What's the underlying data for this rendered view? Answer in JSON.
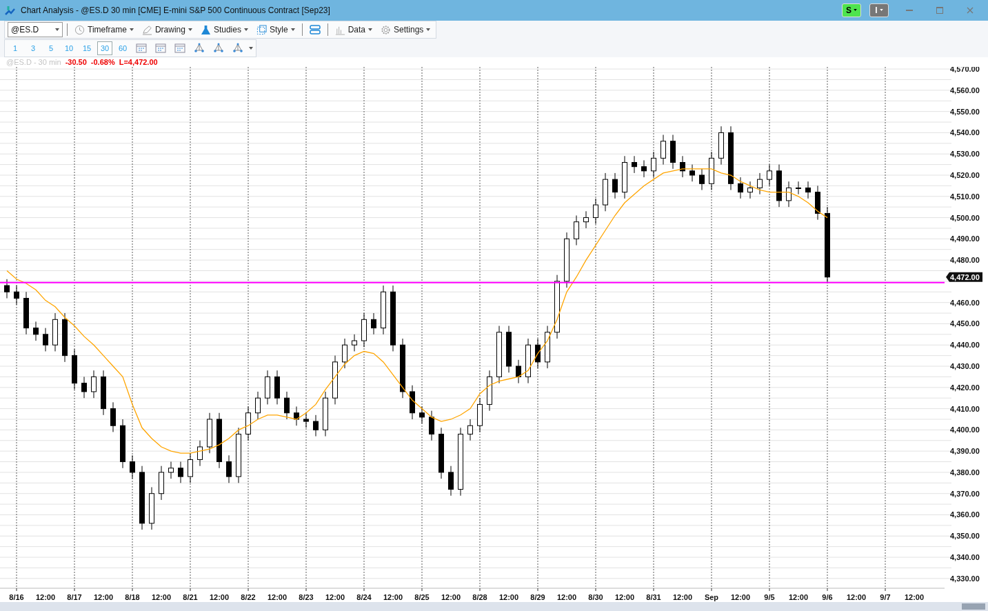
{
  "window": {
    "title": "Chart Analysis - @ES.D 30 min [CME] E-mini S&P 500 Continuous Contract [Sep23]",
    "badges": [
      {
        "label": "S",
        "kind": "green"
      },
      {
        "label": "I",
        "kind": "grey"
      }
    ]
  },
  "toolbar": {
    "symbol": "@ES.D",
    "menus": [
      {
        "label": "Timeframe"
      },
      {
        "label": "Drawing"
      },
      {
        "label": "Studies"
      },
      {
        "label": "Style"
      },
      {
        "label": "Data"
      },
      {
        "label": "Settings"
      }
    ]
  },
  "intervals": [
    {
      "label": "1",
      "selected": false
    },
    {
      "label": "3",
      "selected": false
    },
    {
      "label": "5",
      "selected": false
    },
    {
      "label": "10",
      "selected": false
    },
    {
      "label": "15",
      "selected": false
    },
    {
      "label": "30",
      "selected": true
    },
    {
      "label": "60",
      "selected": false
    }
  ],
  "info": {
    "symbol": "@ES.D - 30 min",
    "change": "-30.50",
    "percent": "-0.68%",
    "last": "L=4,472.00"
  },
  "chart": {
    "price_tag": "4,472.00",
    "chart_data": {
      "type": "candlestick",
      "grid": true,
      "ylim": [
        4325.4,
        4571
      ],
      "categories": [
        null,
        "8/16",
        null,
        null,
        "12:00",
        null,
        null,
        "8/17",
        null,
        null,
        "12:00",
        null,
        null,
        "8/18",
        null,
        null,
        "12:00",
        null,
        null,
        "8/21",
        null,
        null,
        "12:00",
        null,
        null,
        "8/22",
        null,
        null,
        "12:00",
        null,
        null,
        "8/23",
        null,
        null,
        "12:00",
        null,
        null,
        "8/24",
        null,
        null,
        "12:00",
        null,
        null,
        "8/25",
        null,
        null,
        "12:00",
        null,
        null,
        "8/28",
        null,
        null,
        "12:00",
        null,
        null,
        "8/29",
        null,
        null,
        "12:00",
        null,
        null,
        "8/30",
        null,
        null,
        "12:00",
        null,
        null,
        "8/31",
        null,
        null,
        "12:00",
        null,
        null,
        "Sep",
        null,
        null,
        "12:00",
        null,
        null,
        "9/5",
        null,
        null,
        "12:00",
        null,
        null,
        "9/6",
        null,
        null,
        "12:00",
        null,
        null,
        "9/7",
        null,
        null,
        "12:00",
        null
      ],
      "ohlc": [
        [
          4468,
          4471,
          4462,
          4465
        ],
        [
          4465,
          4468,
          4459,
          4462
        ],
        [
          4462,
          4465,
          4445,
          4448
        ],
        [
          4448,
          4451,
          4442,
          4445
        ],
        [
          4445,
          4448,
          4437,
          4440
        ],
        [
          4440,
          4455,
          4437,
          4452
        ],
        [
          4452,
          4455,
          4432,
          4435
        ],
        [
          4435,
          4438,
          4419,
          4422
        ],
        [
          4422,
          4425,
          4415,
          4418
        ],
        [
          4418,
          4428,
          4415,
          4425
        ],
        [
          4425,
          4428,
          4407,
          4410
        ],
        [
          4410,
          4413,
          4399,
          4402
        ],
        [
          4402,
          4405,
          4382,
          4385
        ],
        [
          4385,
          4388,
          4377,
          4380
        ],
        [
          4380,
          4383,
          4353,
          4356
        ],
        [
          4356,
          4373,
          4353,
          4370
        ],
        [
          4370,
          4383,
          4367,
          4380
        ],
        [
          4380,
          4385,
          4377,
          4382
        ],
        [
          4382,
          4385,
          4375,
          4378
        ],
        [
          4378,
          4389,
          4375,
          4386
        ],
        [
          4386,
          4395,
          4383,
          4392
        ],
        [
          4392,
          4408,
          4389,
          4405
        ],
        [
          4405,
          4408,
          4382,
          4385
        ],
        [
          4385,
          4388,
          4375,
          4378
        ],
        [
          4378,
          4401,
          4375,
          4398
        ],
        [
          4398,
          4411,
          4395,
          4408
        ],
        [
          4408,
          4418,
          4405,
          4415
        ],
        [
          4415,
          4428,
          4412,
          4425
        ],
        [
          4425,
          4428,
          4412,
          4415
        ],
        [
          4415,
          4418,
          4405,
          4408
        ],
        [
          4408,
          4411,
          4402,
          4405
        ],
        [
          4405,
          4408,
          4401,
          4404
        ],
        [
          4404,
          4407,
          4397,
          4400
        ],
        [
          4400,
          4418,
          4397,
          4415
        ],
        [
          4415,
          4435,
          4412,
          4432
        ],
        [
          4432,
          4443,
          4429,
          4440
        ],
        [
          4440,
          4445,
          4437,
          4442
        ],
        [
          4442,
          4455,
          4439,
          4452
        ],
        [
          4452,
          4455,
          4445,
          4448
        ],
        [
          4448,
          4468,
          4445,
          4465
        ],
        [
          4465,
          4468,
          4437,
          4440
        ],
        [
          4440,
          4443,
          4415,
          4418
        ],
        [
          4418,
          4421,
          4405,
          4408
        ],
        [
          4408,
          4411,
          4403,
          4406
        ],
        [
          4406,
          4409,
          4395,
          4398
        ],
        [
          4398,
          4401,
          4377,
          4380
        ],
        [
          4380,
          4383,
          4369,
          4372
        ],
        [
          4372,
          4401,
          4369,
          4398
        ],
        [
          4398,
          4405,
          4395,
          4402
        ],
        [
          4402,
          4415,
          4399,
          4412
        ],
        [
          4412,
          4428,
          4409,
          4425
        ],
        [
          4425,
          4449,
          4422,
          4446
        ],
        [
          4446,
          4449,
          4427,
          4430
        ],
        [
          4430,
          4433,
          4422,
          4425
        ],
        [
          4425,
          4443,
          4422,
          4440
        ],
        [
          4440,
          4443,
          4429,
          4432
        ],
        [
          4432,
          4449,
          4429,
          4446
        ],
        [
          4446,
          4473,
          4443,
          4470
        ],
        [
          4470,
          4493,
          4467,
          4490
        ],
        [
          4490,
          4501,
          4487,
          4498
        ],
        [
          4498,
          4503,
          4495,
          4500
        ],
        [
          4500,
          4509,
          4497,
          4506
        ],
        [
          4506,
          4521,
          4503,
          4518
        ],
        [
          4518,
          4521,
          4509,
          4512
        ],
        [
          4512,
          4529,
          4509,
          4526
        ],
        [
          4526,
          4529,
          4521,
          4524
        ],
        [
          4524,
          4527,
          4519,
          4522
        ],
        [
          4522,
          4531,
          4519,
          4528
        ],
        [
          4528,
          4539,
          4525,
          4536
        ],
        [
          4536,
          4539,
          4523,
          4526
        ],
        [
          4526,
          4529,
          4519,
          4522
        ],
        [
          4522,
          4525,
          4517,
          4520
        ],
        [
          4520,
          4523,
          4513,
          4516
        ],
        [
          4516,
          4531,
          4513,
          4528
        ],
        [
          4528,
          4543,
          4525,
          4540
        ],
        [
          4540,
          4543,
          4513,
          4516
        ],
        [
          4516,
          4519,
          4509,
          4512
        ],
        [
          4512,
          4517,
          4509,
          4514
        ],
        [
          4514,
          4521,
          4511,
          4518
        ],
        [
          4518,
          4525,
          4515,
          4522
        ],
        [
          4522,
          4525,
          4505,
          4508
        ],
        [
          4508,
          4517,
          4505,
          4514
        ],
        [
          4514,
          4517,
          4511,
          4514
        ],
        [
          4514,
          4517,
          4509,
          4512
        ],
        [
          4512,
          4515,
          4499,
          4502
        ],
        [
          4502,
          4505,
          4469,
          4472
        ],
        null,
        null,
        null,
        null,
        null,
        null,
        null,
        null,
        null,
        null
      ],
      "series": [
        {
          "type": "line",
          "color": "#ffa500",
          "values": [
            4475,
            4471,
            4469,
            4466,
            4461,
            4458,
            4453,
            4449,
            4444,
            4440,
            4435,
            4430,
            4425,
            4412,
            4401,
            4396,
            4392,
            4390,
            4389,
            4389,
            4390,
            4391,
            4393,
            4396,
            4400,
            4402,
            4405,
            4407,
            4407,
            4406,
            4405,
            4408,
            4412,
            4419,
            4425,
            4431,
            4435,
            4437,
            4436,
            4432,
            4426,
            4420,
            4414,
            4410,
            4406,
            4404,
            4405,
            4407,
            4410,
            4417,
            4421,
            4423,
            4424,
            4425,
            4428,
            4436,
            4442,
            4452,
            4465,
            4472,
            4480,
            4487,
            4494,
            4501,
            4507,
            4511,
            4515,
            4518,
            4521,
            4522,
            4523,
            4523,
            4523,
            4523,
            4521,
            4520,
            4517,
            4515,
            4513,
            4512,
            4512,
            4512,
            4510,
            4507,
            4503,
            4500,
            null,
            null,
            null,
            null,
            null,
            null,
            null,
            null,
            null,
            null
          ]
        }
      ],
      "ref_lines": [
        {
          "axis": "y",
          "value": 4469.4,
          "color": "#ff00ff"
        }
      ],
      "yticks": [
        {
          "value": 4570,
          "label": "4,570.00"
        },
        {
          "value": 4560,
          "label": "4,560.00"
        },
        {
          "value": 4550,
          "label": "4,550.00"
        },
        {
          "value": 4540,
          "label": "4,540.00"
        },
        {
          "value": 4530,
          "label": "4,530.00"
        },
        {
          "value": 4520,
          "label": "4,520.00"
        },
        {
          "value": 4510,
          "label": "4,510.00"
        },
        {
          "value": 4500,
          "label": "4,500.00"
        },
        {
          "value": 4490,
          "label": "4,490.00"
        },
        {
          "value": 4480,
          "label": "4,480.00"
        },
        {
          "value": 4460,
          "label": "4,460.00"
        },
        {
          "value": 4450,
          "label": "4,450.00"
        },
        {
          "value": 4440,
          "label": "4,440.00"
        },
        {
          "value": 4430,
          "label": "4,430.00"
        },
        {
          "value": 4420,
          "label": "4,420.00"
        },
        {
          "value": 4410,
          "label": "4,410.00"
        },
        {
          "value": 4400,
          "label": "4,400.00"
        },
        {
          "value": 4390,
          "label": "4,390.00"
        },
        {
          "value": 4380,
          "label": "4,380.00"
        },
        {
          "value": 4370,
          "label": "4,370.00"
        },
        {
          "value": 4360,
          "label": "4,360.00"
        },
        {
          "value": 4350,
          "label": "4,350.00"
        },
        {
          "value": 4340,
          "label": "4,340.00"
        },
        {
          "value": 4330,
          "label": "4,330.00"
        }
      ]
    }
  }
}
